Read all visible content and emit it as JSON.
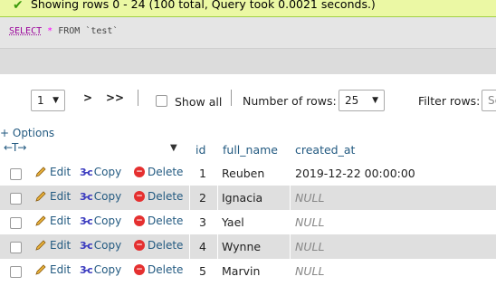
{
  "status": {
    "message": "Showing rows 0 - 24 (100 total, Query took 0.0021 seconds.)"
  },
  "query": {
    "keyword": "SELECT",
    "star": "*",
    "from": "FROM",
    "table": "`test`"
  },
  "navigation": {
    "page_value": "1",
    "next_label": ">",
    "last_label": ">>",
    "show_all_label": "Show all",
    "rows_label": "Number of rows:",
    "rows_value": "25",
    "filter_label": "Filter rows:",
    "filter_placeholder": "Se"
  },
  "options_label": "+ Options",
  "columns": {
    "id": "id",
    "full_name": "full_name",
    "created_at": "created_at"
  },
  "actions": {
    "edit": "Edit",
    "copy": "Copy",
    "delete": "Delete"
  },
  "rows": [
    {
      "id": "1",
      "full_name": "Reuben",
      "created_at": "2019-12-22 00:00:00"
    },
    {
      "id": "2",
      "full_name": "Ignacia",
      "created_at": "NULL"
    },
    {
      "id": "3",
      "full_name": "Yael",
      "created_at": "NULL"
    },
    {
      "id": "4",
      "full_name": "Wynne",
      "created_at": "NULL"
    },
    {
      "id": "5",
      "full_name": "Marvin",
      "created_at": "NULL"
    }
  ],
  "colors": {
    "success_bg": "#ebf8a4",
    "link": "#235a81",
    "row_alt": "#dfdfdf"
  }
}
